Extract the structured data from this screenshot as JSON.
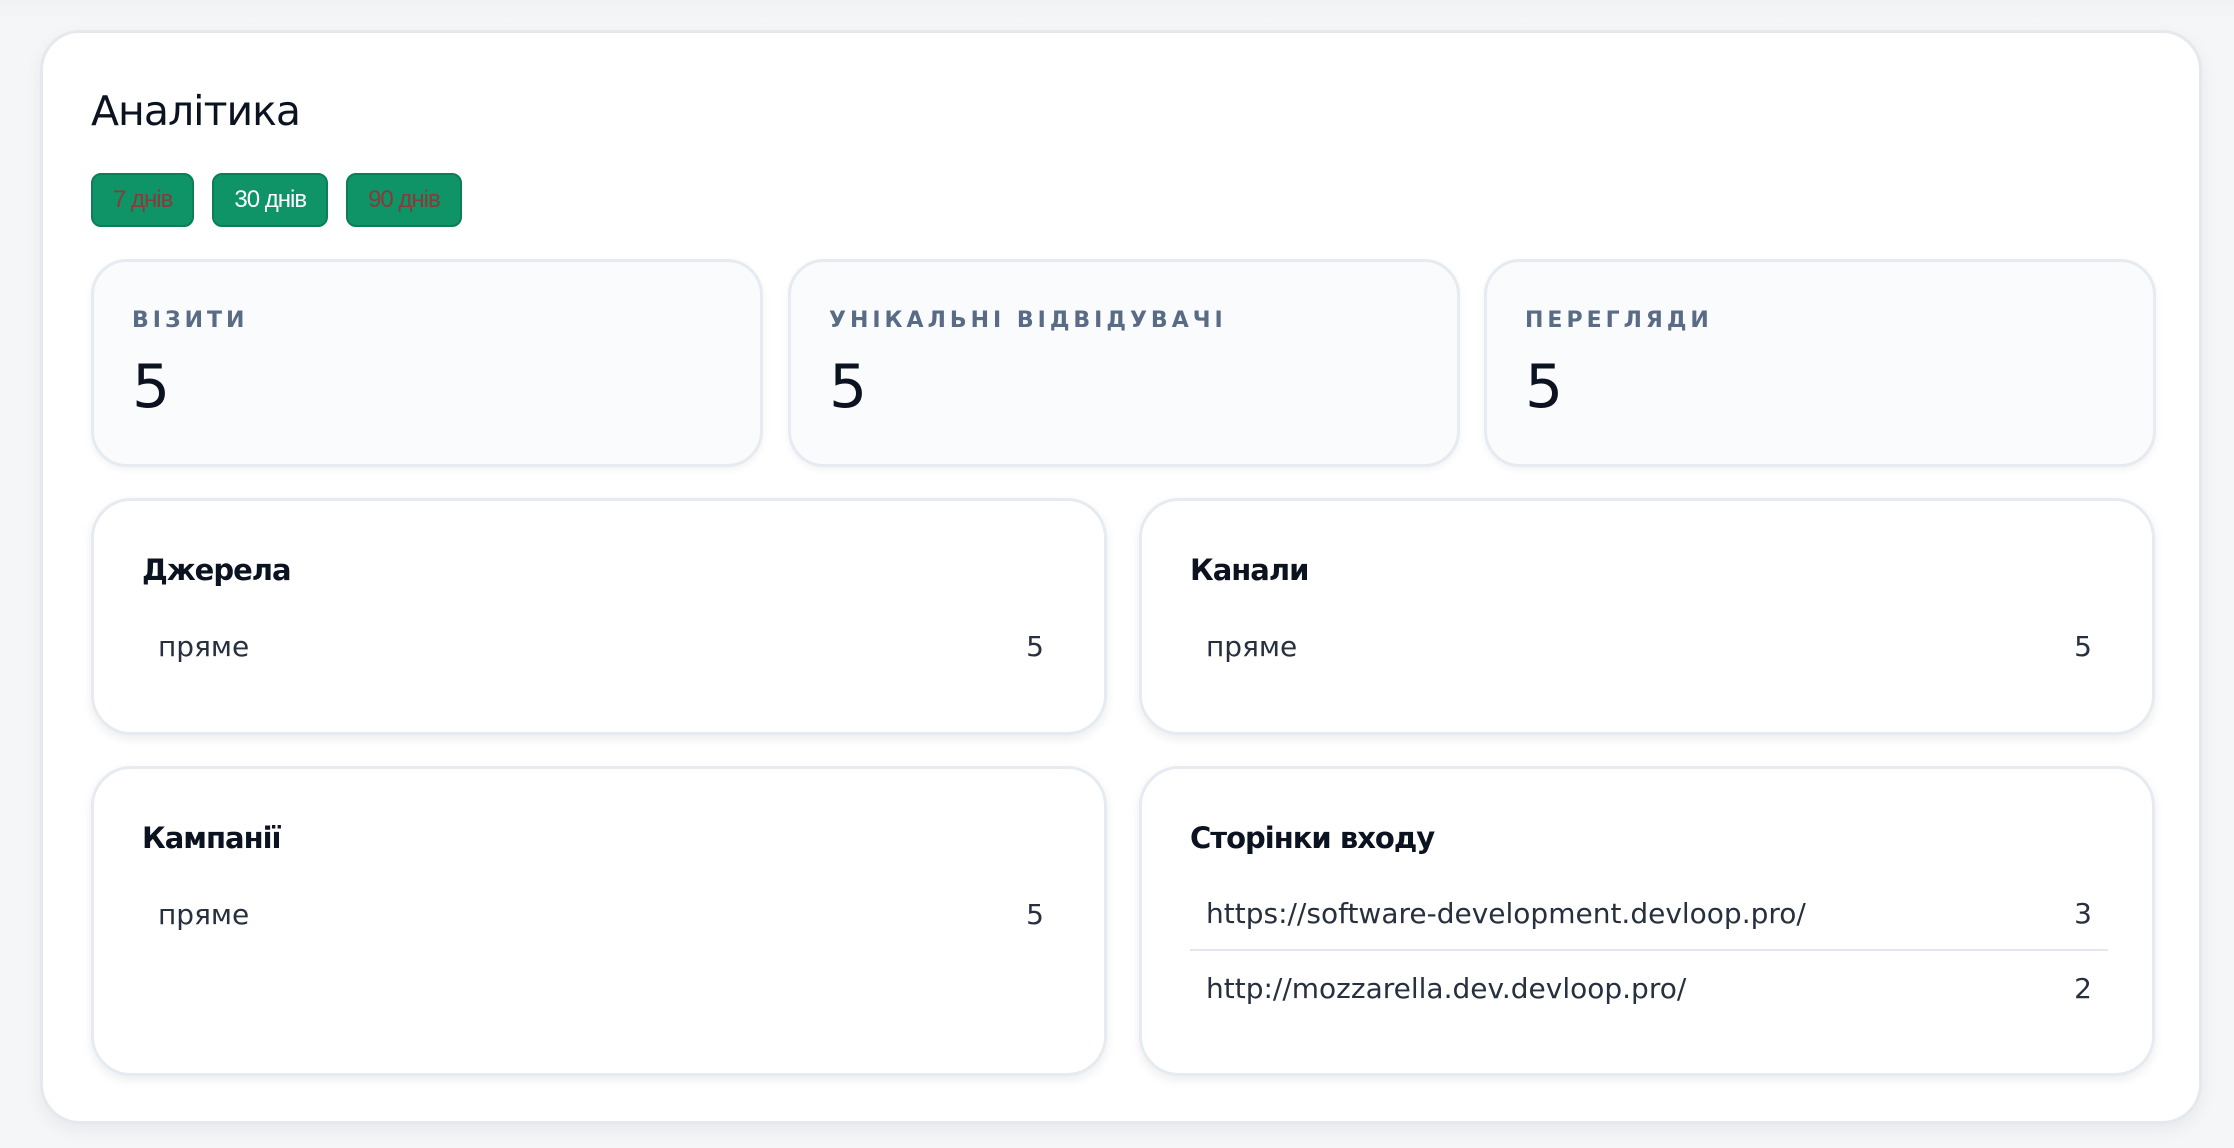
{
  "panel": {
    "title": "Аналітика",
    "ranges": [
      {
        "label": "7 днів",
        "active": false
      },
      {
        "label": "30 днів",
        "active": true
      },
      {
        "label": "90 днів",
        "active": false
      }
    ]
  },
  "stats": [
    {
      "label": "ВІЗИТИ",
      "value": "5"
    },
    {
      "label": "УНІКАЛЬНІ ВІДВІДУВАЧІ",
      "value": "5"
    },
    {
      "label": "ПЕРЕГЛЯДИ",
      "value": "5"
    }
  ],
  "cards": {
    "sources": {
      "title": "Джерела",
      "rows": [
        {
          "name": "пряме",
          "count": "5"
        }
      ]
    },
    "channels": {
      "title": "Канали",
      "rows": [
        {
          "name": "пряме",
          "count": "5"
        }
      ]
    },
    "campaigns": {
      "title": "Кампанії",
      "rows": [
        {
          "name": "пряме",
          "count": "5"
        }
      ]
    },
    "landing": {
      "title": "Сторінки входу",
      "rows": [
        {
          "name": "https://software-development.devloop.pro/",
          "count": "3"
        },
        {
          "name": "http://mozzarella.dev.devloop.pro/",
          "count": "2"
        }
      ]
    }
  },
  "colors": {
    "accent": "#0e9467",
    "inactive_text": "#8b3a3a",
    "label": "#5a6b85"
  }
}
